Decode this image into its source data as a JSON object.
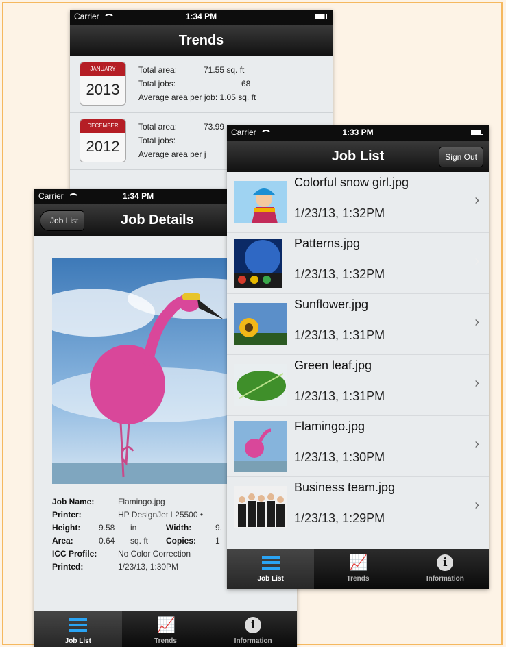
{
  "trends": {
    "status": {
      "carrier": "Carrier",
      "time": "1:34 PM"
    },
    "title": "Trends",
    "rows": [
      {
        "month": "JANUARY",
        "year": "2013",
        "area_label": "Total area:",
        "area": "71.55 sq. ft",
        "jobs_label": "Total jobs:",
        "jobs": "68",
        "avg_label": "Average area per job:",
        "avg": "1.05 sq. ft"
      },
      {
        "month": "DECEMBER",
        "year": "2012",
        "area_label": "Total area:",
        "area": "73.99",
        "jobs_label": "Total jobs:",
        "jobs": "",
        "avg_label": "Average area per j",
        "avg": ""
      }
    ]
  },
  "joblist": {
    "status": {
      "carrier": "Carrier",
      "time": "1:33 PM"
    },
    "title": "Job List",
    "sign_out": "Sign Out",
    "jobs": [
      {
        "name": "Colorful snow girl.jpg",
        "date": "1/23/13, 1:32PM"
      },
      {
        "name": "Patterns.jpg",
        "date": "1/23/13, 1:32PM"
      },
      {
        "name": "Sunflower.jpg",
        "date": "1/23/13, 1:31PM"
      },
      {
        "name": "Green leaf.jpg",
        "date": "1/23/13, 1:31PM"
      },
      {
        "name": "Flamingo.jpg",
        "date": "1/23/13, 1:30PM"
      },
      {
        "name": "Business team.jpg",
        "date": "1/23/13, 1:29PM"
      }
    ],
    "tabs": [
      "Job List",
      "Trends",
      "Information"
    ]
  },
  "details": {
    "status": {
      "carrier": "Carrier",
      "time": "1:34 PM"
    },
    "back": "Job List",
    "title": "Job Details",
    "job_name_label": "Job Name:",
    "job_name": "Flamingo.jpg",
    "printer_label": "Printer:",
    "printer": "HP DesignJet L25500 •",
    "height_label": "Height:",
    "height": "9.58",
    "height_unit": "in",
    "width_label": "Width:",
    "width": "9.",
    "area_label": "Area:",
    "area": "0.64",
    "area_unit": "sq. ft",
    "copies_label": "Copies:",
    "copies": "1",
    "icc_label": "ICC Profile:",
    "icc": "No Color Correction",
    "printed_label": "Printed:",
    "printed": "1/23/13, 1:30PM",
    "tabs": [
      "Job List",
      "Trends",
      "Information"
    ]
  },
  "colors": {
    "accent_blue": "#2aa4f4",
    "calendar_red": "#b51e25",
    "frame": "#f5b85f"
  }
}
